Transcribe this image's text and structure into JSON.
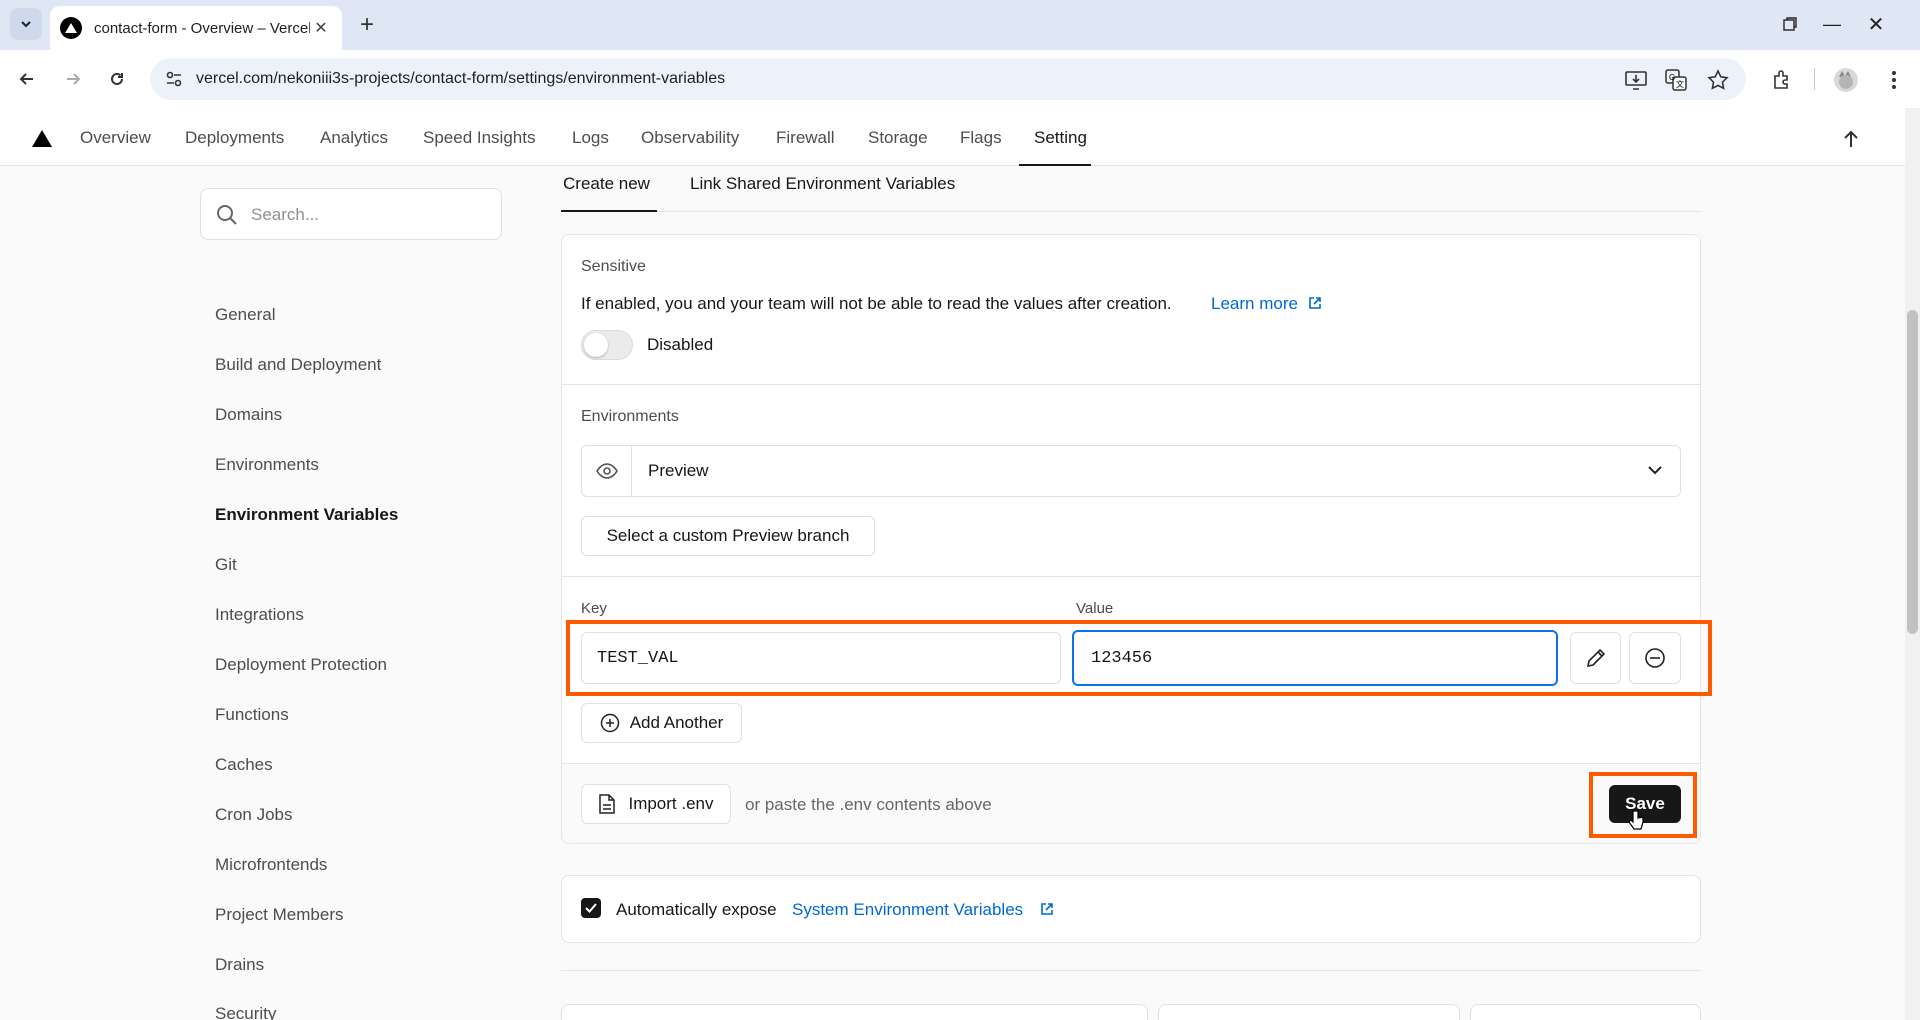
{
  "browser": {
    "tab_title": "contact-form - Overview – Vercel",
    "url": "vercel.com/nekoniii3s-projects/contact-form/settings/environment-variables"
  },
  "project_nav": {
    "items": [
      "Overview",
      "Deployments",
      "Analytics",
      "Speed Insights",
      "Logs",
      "Observability",
      "Firewall",
      "Storage",
      "Flags",
      "Setting"
    ],
    "active": "Setting"
  },
  "sidebar": {
    "search_placeholder": "Search...",
    "items": [
      "General",
      "Build and Deployment",
      "Domains",
      "Environments",
      "Environment Variables",
      "Git",
      "Integrations",
      "Deployment Protection",
      "Functions",
      "Caches",
      "Cron Jobs",
      "Microfrontends",
      "Project Members",
      "Drains",
      "Security"
    ],
    "active": "Environment Variables"
  },
  "subtabs": {
    "create_new": "Create new",
    "link_shared": "Link Shared Environment Variables"
  },
  "sensitive": {
    "heading": "Sensitive",
    "description": "If enabled, you and your team will not be able to read the values after creation.",
    "learn_more": "Learn more",
    "toggle_label": "Disabled"
  },
  "environments": {
    "heading": "Environments",
    "selected": "Preview",
    "custom_branch_button": "Select a custom Preview branch"
  },
  "kv": {
    "key_label": "Key",
    "value_label": "Value",
    "key": "TEST_VAL",
    "value": "123456",
    "add_another": "Add Another"
  },
  "import": {
    "button": "Import .env",
    "hint": "or paste the .env contents above",
    "save": "Save"
  },
  "expose": {
    "prefix": "Automatically expose",
    "link": "System Environment Variables"
  },
  "colors": {
    "highlight": "#ff5a00",
    "link": "#0068d6",
    "focus": "#0a72ef"
  }
}
